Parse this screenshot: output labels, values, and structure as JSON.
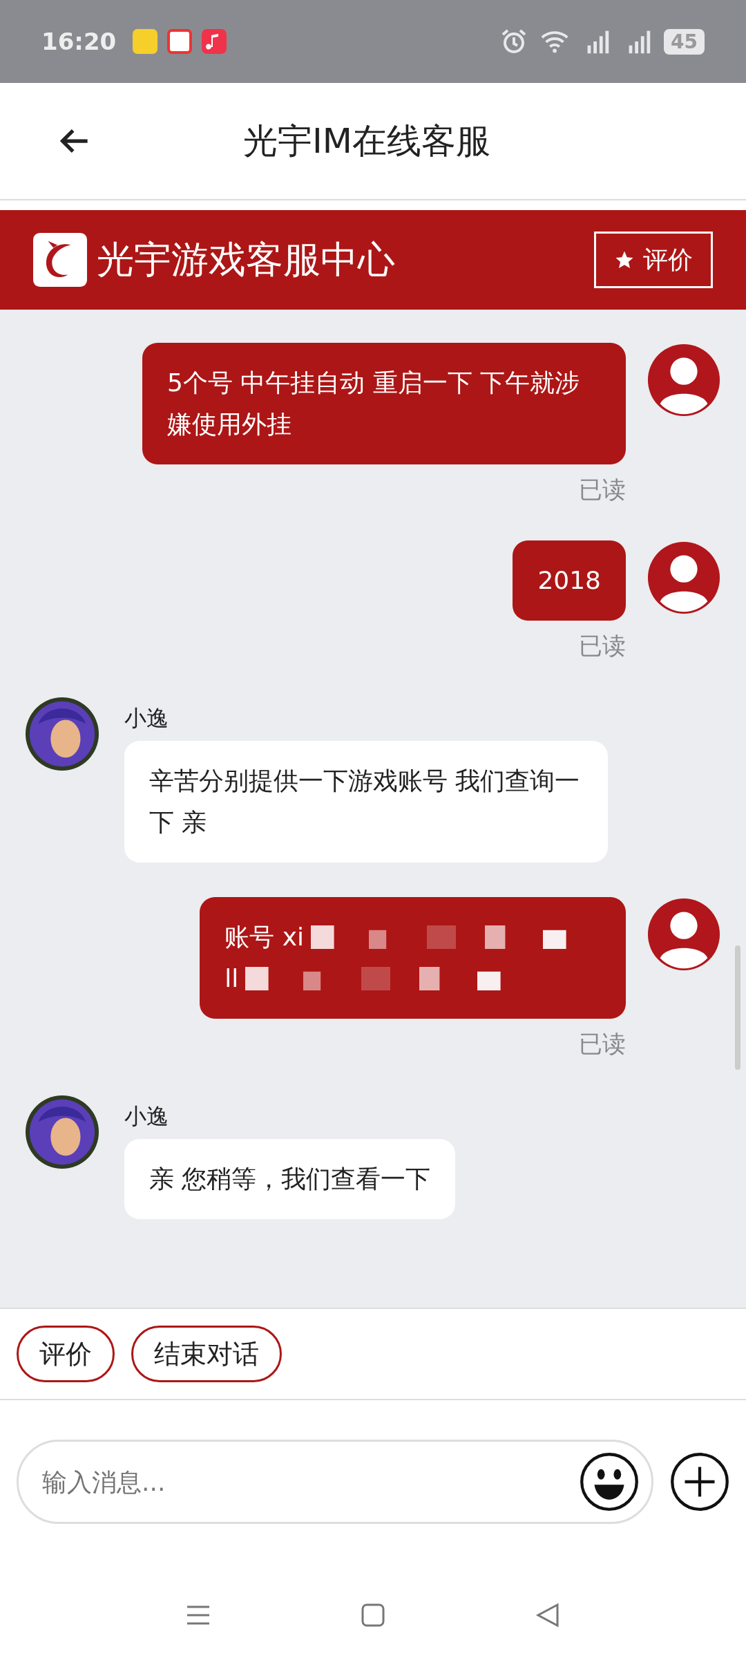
{
  "status_bar": {
    "time": "16:20",
    "battery": "45"
  },
  "top_bar": {
    "title": "光宇IM在线客服"
  },
  "banner": {
    "title": "光宇游戏客服中心",
    "rate_button": "评价"
  },
  "messages": [
    {
      "kind": "sent",
      "lines": [
        "5个号 中午挂自动 重启一下 下午就涉嫌使用外挂"
      ],
      "receipt": "已读"
    },
    {
      "kind": "sent",
      "lines": [
        "2018"
      ],
      "receipt": "已读"
    },
    {
      "kind": "received",
      "sender": "小逸",
      "lines": [
        "辛苦分别提供一下游戏账号 我们查询一下 亲"
      ]
    },
    {
      "kind": "redacted",
      "lines": [
        "账号 xi",
        "ll"
      ],
      "receipt": "已读"
    },
    {
      "kind": "received",
      "sender": "小逸",
      "lines": [
        "亲 您稍等，我们查看一下"
      ]
    }
  ],
  "quick_actions": [
    "评价",
    "结束对话"
  ],
  "composer": {
    "placeholder": "输入消息..."
  }
}
